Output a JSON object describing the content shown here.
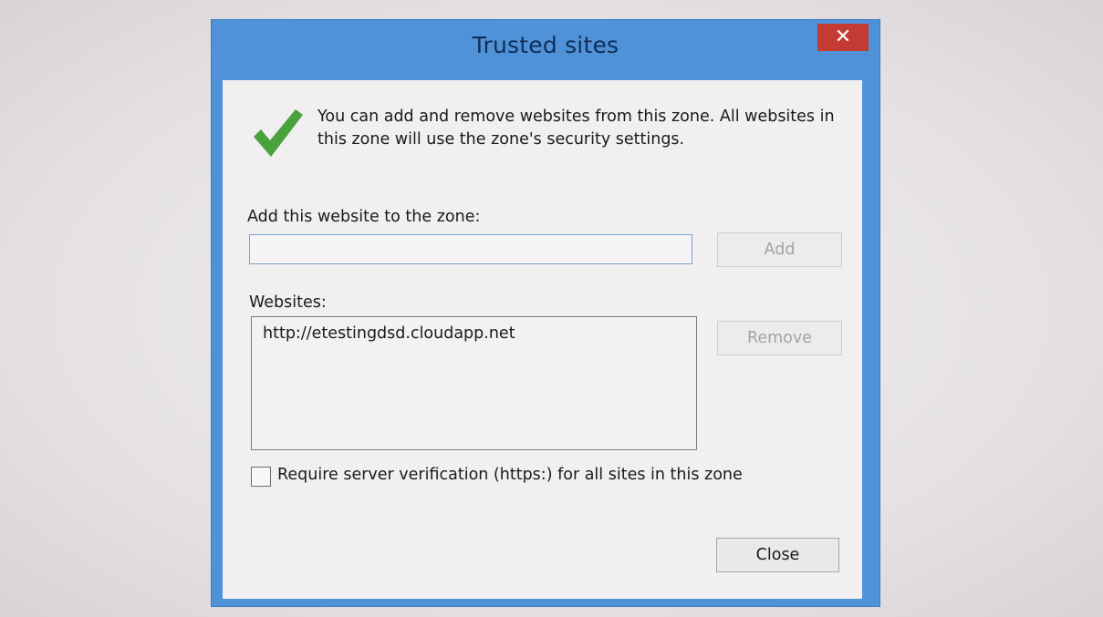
{
  "dialog": {
    "title": "Trusted sites",
    "close_glyph": "✕",
    "intro_text": "You can add and remove websites from this zone. All websites in this zone will use the zone's security settings.",
    "icon": "check-icon",
    "add_label": "Add this website to the zone:",
    "add_input": {
      "value": "",
      "placeholder": ""
    },
    "add_button": "Add",
    "websites_label": "Websites:",
    "websites": [
      "http://etestingdsd.cloudapp.net"
    ],
    "remove_button": "Remove",
    "https_checkbox": {
      "label": "Require server verification (https:) for all sites in this zone",
      "checked": false
    },
    "close_button": "Close"
  },
  "colors": {
    "frame": "#4f92d8",
    "title_text": "#0f2e58",
    "close_x": "#c33b32",
    "check_green": "#4aa33a",
    "disabled_text": "#a4a2a6"
  }
}
